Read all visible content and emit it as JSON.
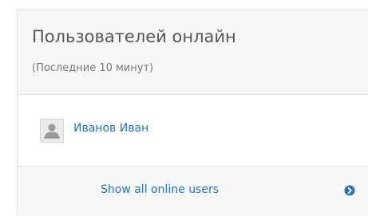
{
  "panel": {
    "title": "Пользователей онлайн",
    "subtitle": "(Последние 10 минут)"
  },
  "users": [
    {
      "name": "Иванов Иван",
      "avatar_icon": "user-silhouette-icon"
    }
  ],
  "footer": {
    "link_label": "Show all online users",
    "icon": "arrow-circle-right-icon"
  },
  "colors": {
    "link": "#2b71b9",
    "header_bg": "#f7f7f7",
    "title_text": "#555555"
  }
}
